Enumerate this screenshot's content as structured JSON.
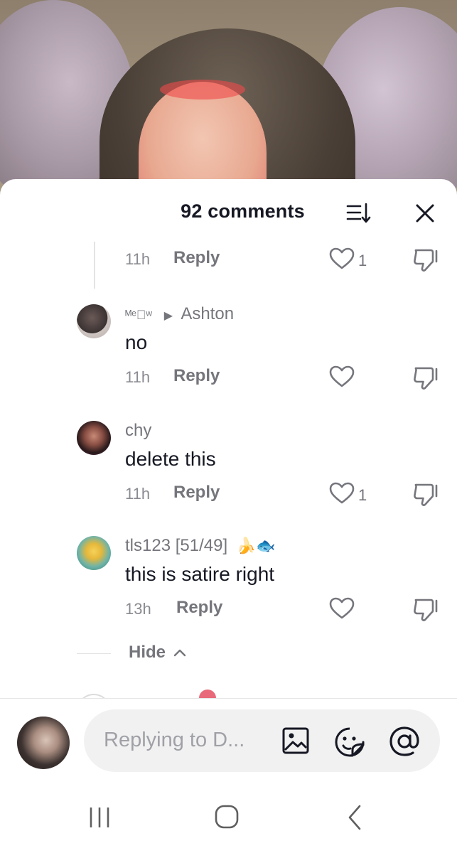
{
  "header": {
    "comment_count_label": "92 comments"
  },
  "comments": [
    {
      "time": "11h",
      "reply_label": "Reply",
      "likes": "1"
    },
    {
      "username": "ᴹᵉ⃒ʷ",
      "reply_to": "Ashton",
      "text": "no",
      "time": "11h",
      "reply_label": "Reply",
      "likes": ""
    },
    {
      "username": "chy",
      "text": "delete this",
      "time": "11h",
      "reply_label": "Reply",
      "likes": "1"
    },
    {
      "username": "tls123 [51/49]",
      "username_emoji": "🍌🐟",
      "text": "this is satire right",
      "time": "13h",
      "reply_label": "Reply",
      "likes": ""
    }
  ],
  "hide_label": "Hide",
  "composer": {
    "placeholder": "Replying to D..."
  },
  "icons": {
    "sort": "sort-icon",
    "close": "close-icon",
    "like": "heart-icon",
    "dislike": "dislike-icon",
    "image": "image-icon",
    "emoji": "emoji-icon",
    "mention": "at-icon"
  },
  "colors": {
    "text_primary": "#161823",
    "text_secondary": "#75767c",
    "input_bg": "#f1f1f2"
  }
}
